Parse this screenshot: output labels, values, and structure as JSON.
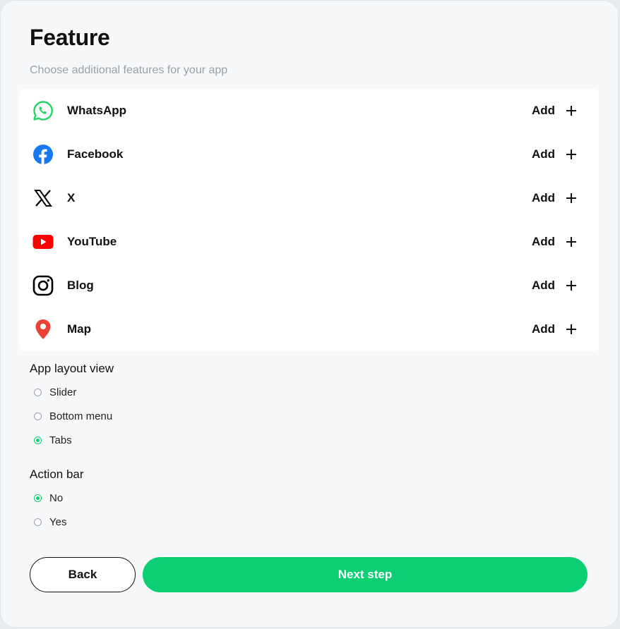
{
  "header": {
    "title": "Feature",
    "subtitle": "Choose additional features for your app"
  },
  "features": [
    {
      "name": "WhatsApp",
      "action": "Add",
      "icon": "whatsapp-icon",
      "color": "#25D366"
    },
    {
      "name": "Facebook",
      "action": "Add",
      "icon": "facebook-icon",
      "color": "#1877F2"
    },
    {
      "name": "X",
      "action": "Add",
      "icon": "x-icon",
      "color": "#000000"
    },
    {
      "name": "YouTube",
      "action": "Add",
      "icon": "youtube-icon",
      "color": "#FF0000"
    },
    {
      "name": "Blog",
      "action": "Add",
      "icon": "instagram-icon",
      "color": "#000000"
    },
    {
      "name": "Map",
      "action": "Add",
      "icon": "map-pin-icon",
      "color": "#EA4335"
    }
  ],
  "layout_view": {
    "label": "App layout view",
    "options": [
      {
        "label": "Slider",
        "checked": false
      },
      {
        "label": "Bottom menu",
        "checked": false
      },
      {
        "label": "Tabs",
        "checked": true
      }
    ]
  },
  "action_bar": {
    "label": "Action bar",
    "options": [
      {
        "label": "No",
        "checked": true
      },
      {
        "label": "Yes",
        "checked": false
      }
    ]
  },
  "buttons": {
    "back": "Back",
    "next": "Next step"
  },
  "colors": {
    "accent": "#0CCF73",
    "background": "#F6F8FA"
  }
}
